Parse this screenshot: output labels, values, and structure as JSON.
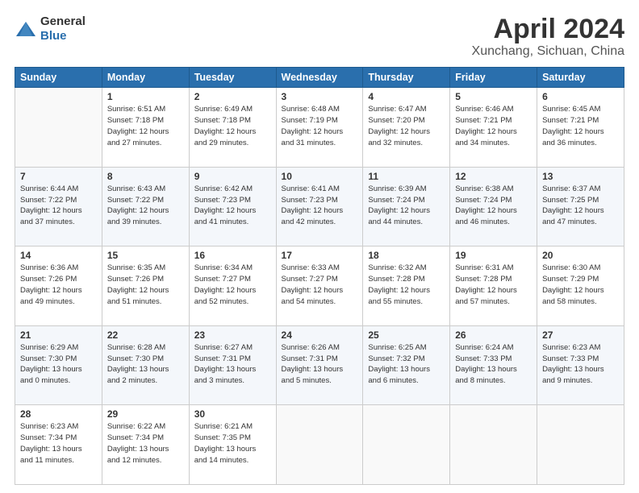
{
  "header": {
    "logo_general": "General",
    "logo_blue": "Blue",
    "title": "April 2024",
    "location": "Xunchang, Sichuan, China"
  },
  "weekdays": [
    "Sunday",
    "Monday",
    "Tuesday",
    "Wednesday",
    "Thursday",
    "Friday",
    "Saturday"
  ],
  "weeks": [
    [
      {
        "day": "",
        "info": ""
      },
      {
        "day": "1",
        "info": "Sunrise: 6:51 AM\nSunset: 7:18 PM\nDaylight: 12 hours\nand 27 minutes."
      },
      {
        "day": "2",
        "info": "Sunrise: 6:49 AM\nSunset: 7:18 PM\nDaylight: 12 hours\nand 29 minutes."
      },
      {
        "day": "3",
        "info": "Sunrise: 6:48 AM\nSunset: 7:19 PM\nDaylight: 12 hours\nand 31 minutes."
      },
      {
        "day": "4",
        "info": "Sunrise: 6:47 AM\nSunset: 7:20 PM\nDaylight: 12 hours\nand 32 minutes."
      },
      {
        "day": "5",
        "info": "Sunrise: 6:46 AM\nSunset: 7:21 PM\nDaylight: 12 hours\nand 34 minutes."
      },
      {
        "day": "6",
        "info": "Sunrise: 6:45 AM\nSunset: 7:21 PM\nDaylight: 12 hours\nand 36 minutes."
      }
    ],
    [
      {
        "day": "7",
        "info": "Sunrise: 6:44 AM\nSunset: 7:22 PM\nDaylight: 12 hours\nand 37 minutes."
      },
      {
        "day": "8",
        "info": "Sunrise: 6:43 AM\nSunset: 7:22 PM\nDaylight: 12 hours\nand 39 minutes."
      },
      {
        "day": "9",
        "info": "Sunrise: 6:42 AM\nSunset: 7:23 PM\nDaylight: 12 hours\nand 41 minutes."
      },
      {
        "day": "10",
        "info": "Sunrise: 6:41 AM\nSunset: 7:23 PM\nDaylight: 12 hours\nand 42 minutes."
      },
      {
        "day": "11",
        "info": "Sunrise: 6:39 AM\nSunset: 7:24 PM\nDaylight: 12 hours\nand 44 minutes."
      },
      {
        "day": "12",
        "info": "Sunrise: 6:38 AM\nSunset: 7:24 PM\nDaylight: 12 hours\nand 46 minutes."
      },
      {
        "day": "13",
        "info": "Sunrise: 6:37 AM\nSunset: 7:25 PM\nDaylight: 12 hours\nand 47 minutes."
      }
    ],
    [
      {
        "day": "14",
        "info": "Sunrise: 6:36 AM\nSunset: 7:26 PM\nDaylight: 12 hours\nand 49 minutes."
      },
      {
        "day": "15",
        "info": "Sunrise: 6:35 AM\nSunset: 7:26 PM\nDaylight: 12 hours\nand 51 minutes."
      },
      {
        "day": "16",
        "info": "Sunrise: 6:34 AM\nSunset: 7:27 PM\nDaylight: 12 hours\nand 52 minutes."
      },
      {
        "day": "17",
        "info": "Sunrise: 6:33 AM\nSunset: 7:27 PM\nDaylight: 12 hours\nand 54 minutes."
      },
      {
        "day": "18",
        "info": "Sunrise: 6:32 AM\nSunset: 7:28 PM\nDaylight: 12 hours\nand 55 minutes."
      },
      {
        "day": "19",
        "info": "Sunrise: 6:31 AM\nSunset: 7:28 PM\nDaylight: 12 hours\nand 57 minutes."
      },
      {
        "day": "20",
        "info": "Sunrise: 6:30 AM\nSunset: 7:29 PM\nDaylight: 12 hours\nand 58 minutes."
      }
    ],
    [
      {
        "day": "21",
        "info": "Sunrise: 6:29 AM\nSunset: 7:30 PM\nDaylight: 13 hours\nand 0 minutes."
      },
      {
        "day": "22",
        "info": "Sunrise: 6:28 AM\nSunset: 7:30 PM\nDaylight: 13 hours\nand 2 minutes."
      },
      {
        "day": "23",
        "info": "Sunrise: 6:27 AM\nSunset: 7:31 PM\nDaylight: 13 hours\nand 3 minutes."
      },
      {
        "day": "24",
        "info": "Sunrise: 6:26 AM\nSunset: 7:31 PM\nDaylight: 13 hours\nand 5 minutes."
      },
      {
        "day": "25",
        "info": "Sunrise: 6:25 AM\nSunset: 7:32 PM\nDaylight: 13 hours\nand 6 minutes."
      },
      {
        "day": "26",
        "info": "Sunrise: 6:24 AM\nSunset: 7:33 PM\nDaylight: 13 hours\nand 8 minutes."
      },
      {
        "day": "27",
        "info": "Sunrise: 6:23 AM\nSunset: 7:33 PM\nDaylight: 13 hours\nand 9 minutes."
      }
    ],
    [
      {
        "day": "28",
        "info": "Sunrise: 6:23 AM\nSunset: 7:34 PM\nDaylight: 13 hours\nand 11 minutes."
      },
      {
        "day": "29",
        "info": "Sunrise: 6:22 AM\nSunset: 7:34 PM\nDaylight: 13 hours\nand 12 minutes."
      },
      {
        "day": "30",
        "info": "Sunrise: 6:21 AM\nSunset: 7:35 PM\nDaylight: 13 hours\nand 14 minutes."
      },
      {
        "day": "",
        "info": ""
      },
      {
        "day": "",
        "info": ""
      },
      {
        "day": "",
        "info": ""
      },
      {
        "day": "",
        "info": ""
      }
    ]
  ]
}
